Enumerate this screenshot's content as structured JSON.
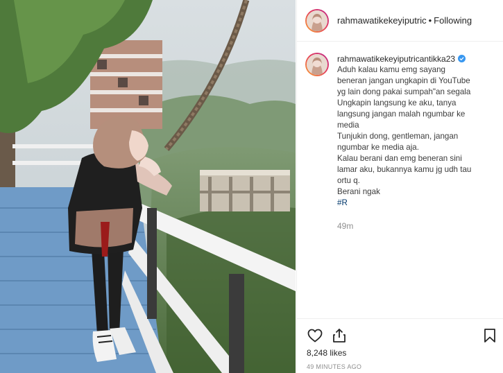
{
  "post": {
    "header": {
      "username": "rahmawatikekeyiputric",
      "separator": "•",
      "follow_status": "Following"
    },
    "caption": {
      "username": "rahmawatikekeyiputricantikka23",
      "lines": [
        "Aduh kalau kamu emg sayang",
        "beneran jangan ungkapin di YouTube",
        "yg lain dong pakai sumpah\"an segala",
        "Ungkapin langsung ke aku, tanya",
        "langsung jangan malah ngumbar ke",
        "media",
        "Tunjukin dong, gentleman, jangan",
        "ngumbar ke media aja.",
        "Kalau berani dan emg beneran sini",
        "lamar aku, bukannya kamu jg udh tau",
        "ortu q.",
        "Berani ngak"
      ],
      "hashtag": "#R",
      "time_ago": "49m"
    },
    "actions": {
      "like_icon": "heart-icon",
      "share_icon": "share-icon",
      "save_icon": "bookmark-icon"
    },
    "likes": "8,248 likes",
    "timestamp": "49 MINUTES AGO"
  },
  "colors": {
    "text": "#262626",
    "muted": "#8e8e8e",
    "hashtag": "#00376b",
    "verified": "#3897f0",
    "border": "#efefef"
  }
}
